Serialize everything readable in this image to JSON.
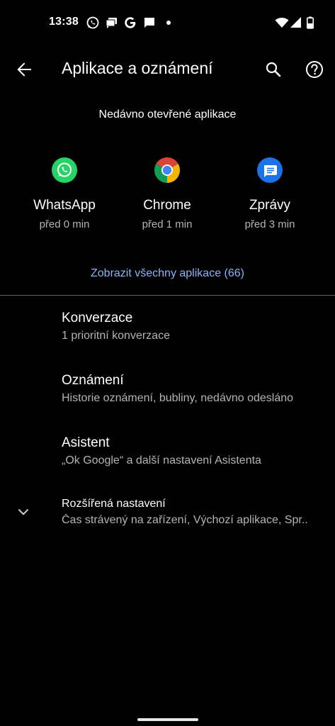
{
  "status_bar": {
    "time": "13:38",
    "icons": [
      "whatsapp-notification-icon",
      "messages-notification-icon",
      "google-notification-icon",
      "chat-notification-icon",
      "dot-icon",
      "wifi-icon",
      "signal-icon",
      "battery-icon"
    ]
  },
  "app_bar": {
    "title": "Aplikace a oznámení",
    "back_icon": "arrow-back-icon",
    "search_icon": "search-icon",
    "help_icon": "help-icon"
  },
  "recent": {
    "header": "Nedávno otevřené aplikace",
    "apps": [
      {
        "name": "WhatsApp",
        "time": "před 0 min",
        "icon": "whatsapp-icon",
        "color": "#25d366"
      },
      {
        "name": "Chrome",
        "time": "před 1 min",
        "icon": "chrome-icon",
        "color": "#4285f4"
      },
      {
        "name": "Zprávy",
        "time": "před 3 min",
        "icon": "messages-icon",
        "color": "#1a73e8"
      }
    ],
    "see_all": "Zobrazit všechny aplikace (66)"
  },
  "settings": [
    {
      "title": "Konverzace",
      "subtitle": "1 prioritní konverzace"
    },
    {
      "title": "Oznámení",
      "subtitle": "Historie oznámení, bubliny, nedávno odesláno"
    },
    {
      "title": "Asistent",
      "subtitle": "„Ok Google“ a další nastavení Asistenta"
    },
    {
      "title": "Rozšířená nastavení",
      "subtitle": "Čas strávený na zařízení, Výchozí aplikace, Spr..",
      "icon": "chevron-down-icon"
    }
  ],
  "colors": {
    "background": "#000000",
    "accent_link": "#8ab4f8",
    "secondary_text": "#b4b4b4"
  }
}
